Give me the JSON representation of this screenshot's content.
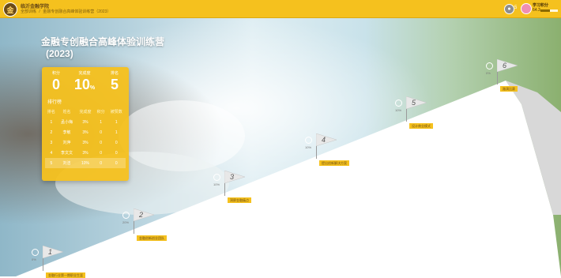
{
  "header": {
    "logo_char": "金",
    "org_name": "临沂金融学院",
    "breadcrumb": [
      "全部训练",
      "/",
      "金融专创融合高峰体验训练营（2023）"
    ],
    "bell_glyph": "●",
    "notification_count": "5",
    "user_name": "学习积分",
    "user_level": "64.3",
    "level_progress": 0.55
  },
  "hero": {
    "title": "金融专创融合高峰体验训练营",
    "year": "(2023)"
  },
  "stats": [
    {
      "label": "积分",
      "value": "0",
      "unit": ""
    },
    {
      "label": "完成度",
      "value": "10",
      "unit": "%"
    },
    {
      "label": "排名",
      "value": "5",
      "unit": ""
    }
  ],
  "ranking": {
    "title": "排行榜",
    "columns": [
      "排名",
      "姓名",
      "完成度",
      "积分",
      "被赞数"
    ],
    "rows": [
      [
        "1",
        "孟小梅",
        "3%",
        "1",
        "1"
      ],
      [
        "2",
        "李敏",
        "3%",
        "0",
        "1"
      ],
      [
        "3",
        "刘萍",
        "3%",
        "0",
        "0"
      ],
      [
        "4",
        "李文文",
        "3%",
        "0",
        "0"
      ],
      [
        "5",
        "刘洁",
        "10%",
        "0",
        "0"
      ]
    ]
  },
  "steps": [
    {
      "num": "1",
      "pct": "0%",
      "label": "金融行业第一期职业生涯"
    },
    {
      "num": "2",
      "pct": "20%",
      "label": "金融创新创业团队"
    },
    {
      "num": "3",
      "pct": "10%",
      "label": "洞察金融痛点"
    },
    {
      "num": "4",
      "pct": "10%",
      "label": "提出创新解决方案"
    },
    {
      "num": "5",
      "pct": "10%",
      "label": "设计商业模式"
    },
    {
      "num": "6",
      "pct": "0%",
      "label": "路演比赛"
    }
  ],
  "colors": {
    "accent": "#f5c11e",
    "header": "#f5c11e",
    "brown": "#6b4b16"
  }
}
